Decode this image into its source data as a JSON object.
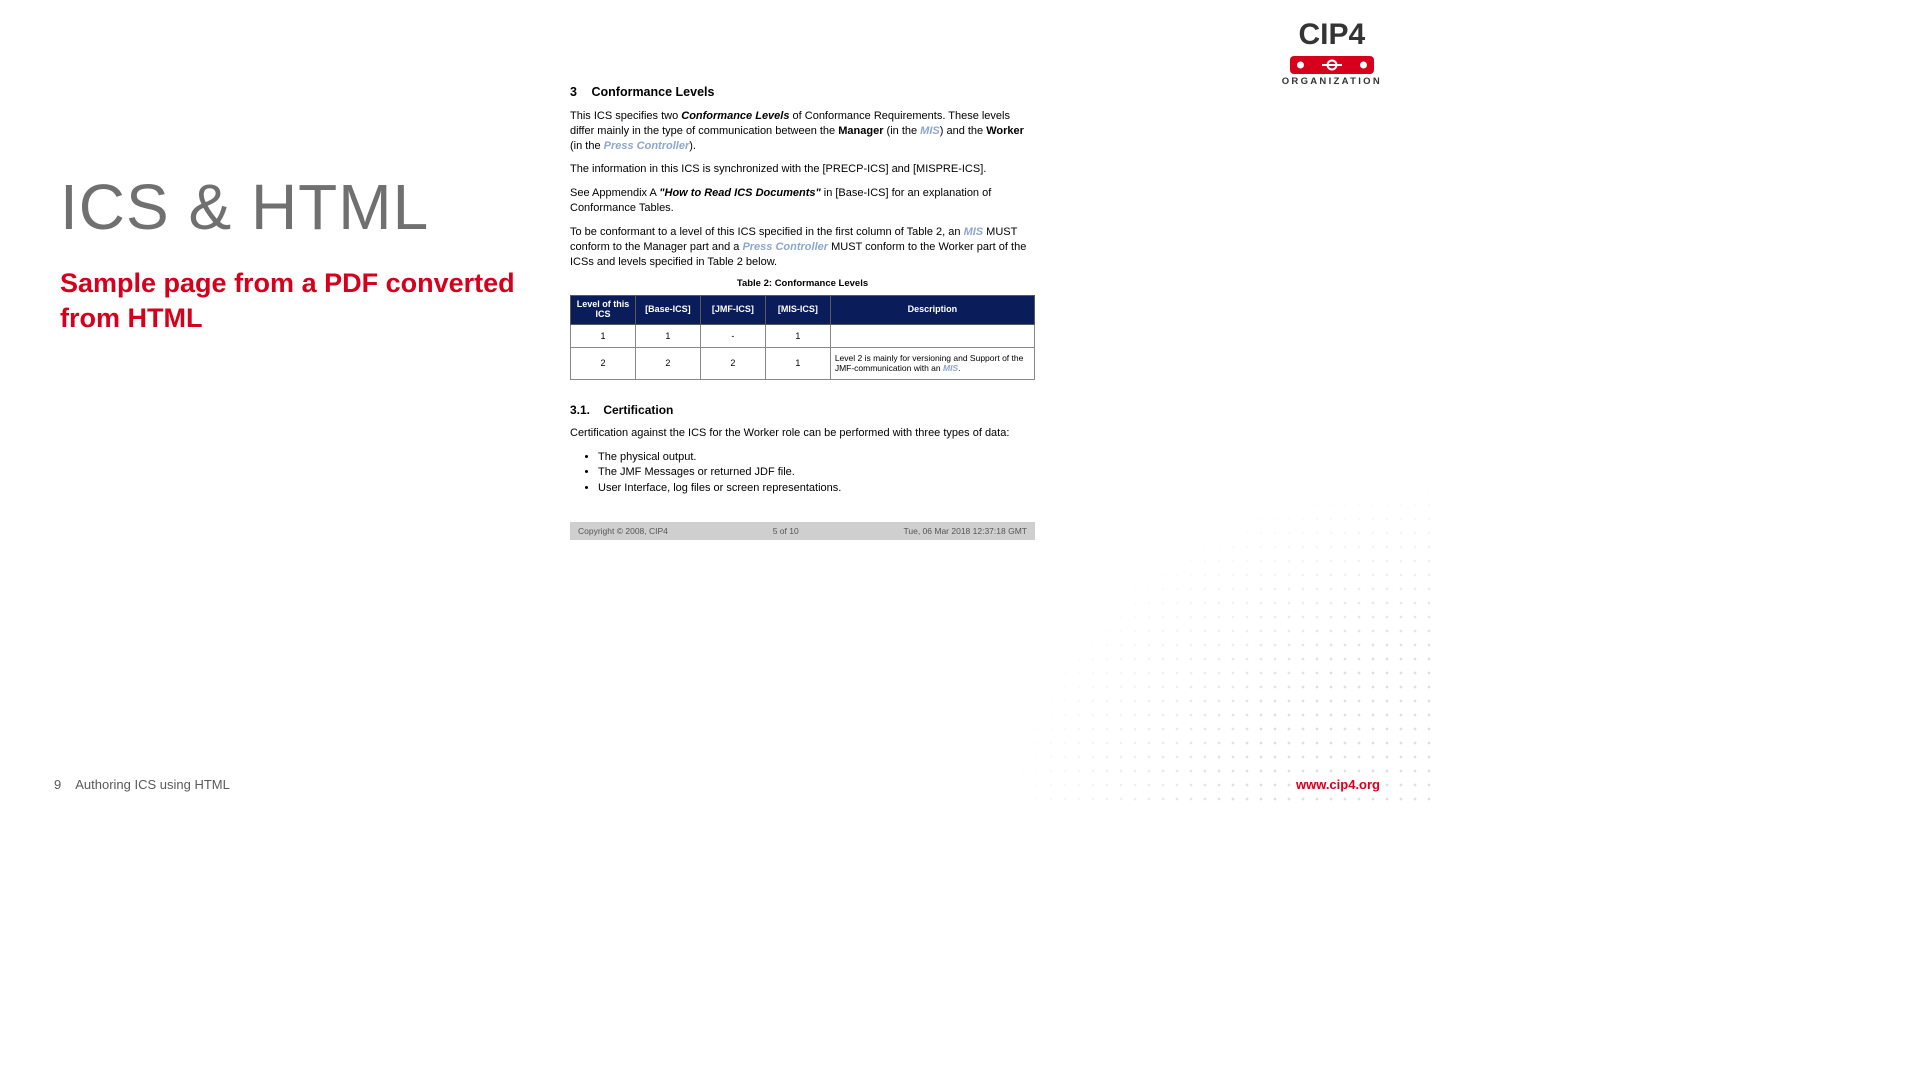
{
  "slide": {
    "title": "ICS & HTML",
    "subtitle": "Sample page from a PDF converted from HTML"
  },
  "logo": {
    "brand": "CIP4",
    "sub": "ORGANIZATION"
  },
  "footer": {
    "page": "9",
    "caption": "Authoring ICS using HTML",
    "url": "www.cip4.org"
  },
  "doc": {
    "section_num": "3",
    "section_title": "Conformance Levels",
    "p1_a": "This ICS specifies two ",
    "p1_b": "Conformance Levels",
    "p1_c": " of Conformance Requirements. These levels differ mainly in the type of communication between the ",
    "p1_d": "Manager",
    "p1_e": " (in the ",
    "p1_f": "MIS",
    "p1_g": ") and the ",
    "p1_h": "Worker",
    "p1_i": " (in the ",
    "p1_j": "Press Controller",
    "p1_k": ").",
    "p2": "The information in this ICS is synchronized with the [PRECP-ICS] and [MISPRE-ICS].",
    "p3_a": "See Appmendix A ",
    "p3_b": "\"How to Read ICS Documents\"",
    "p3_c": " in [Base-ICS] for an explanation of Conformance Tables.",
    "p4_a": "To be conformant to a level of this ICS specified in the first column of Table 2, an ",
    "p4_b": "MIS",
    "p4_c": " MUST conform to the Manager part and a ",
    "p4_d": "Press Controller",
    "p4_e": " MUST conform to the Worker part of the ICSs and levels specified in Table 2 below.",
    "table_caption": "Table 2:  Conformance Levels",
    "table": {
      "headers": [
        "Level of this ICS",
        "[Base-ICS]",
        "[JMF-ICS]",
        "[MIS-ICS]",
        "Description"
      ],
      "rows": [
        {
          "c0": "1",
          "c1": "1",
          "c2": "-",
          "c3": "1",
          "desc_a": "",
          "desc_b": "",
          "desc_c": ""
        },
        {
          "c0": "2",
          "c1": "2",
          "c2": "2",
          "c3": "1",
          "desc_a": "Level 2 is mainly for versioning and Support of the JMF-communication with an ",
          "desc_b": "MIS",
          "desc_c": "."
        }
      ]
    },
    "subsec_num": "3.1.",
    "subsec_title": "Certification",
    "p5": "Certification against the ICS for the Worker role can be performed with three types of data:",
    "bullets": [
      "The physical output.",
      "The JMF Messages or returned JDF file.",
      "User Interface, log files or screen representations."
    ],
    "docfooter": {
      "left": "Copyright © 2008, CIP4",
      "center": "5 of 10",
      "right": "Tue, 06 Mar 2018 12:37:18 GMT"
    }
  }
}
